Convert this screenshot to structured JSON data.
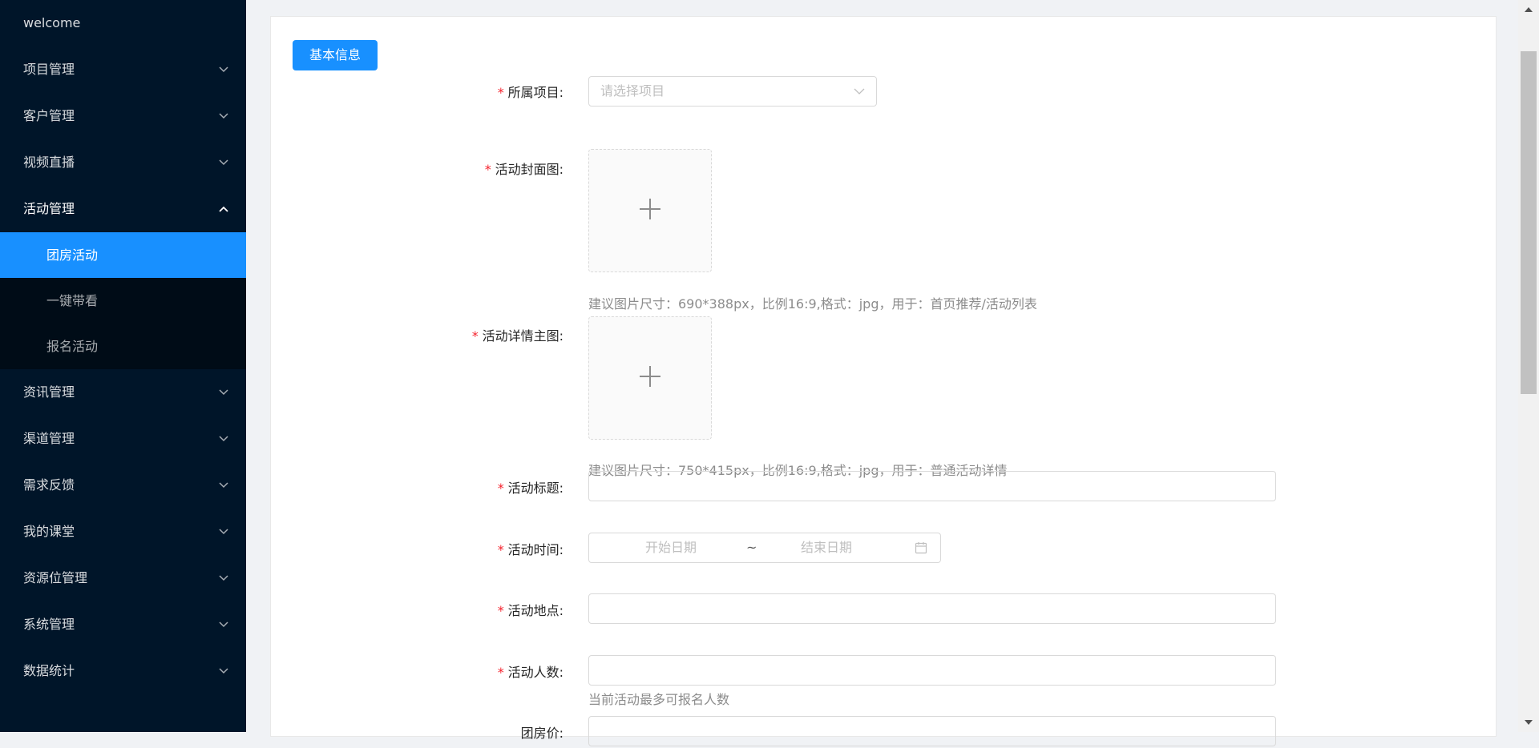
{
  "sidebar": {
    "welcome": "welcome",
    "menus_top": [
      {
        "label": "项目管理"
      },
      {
        "label": "客户管理"
      },
      {
        "label": "视频直播"
      }
    ],
    "open_menu": {
      "label": "活动管理",
      "items": [
        {
          "label": "团房活动",
          "active": true
        },
        {
          "label": "一键带看",
          "active": false
        },
        {
          "label": "报名活动",
          "active": false
        }
      ]
    },
    "menus_bottom": [
      {
        "label": "资讯管理"
      },
      {
        "label": "渠道管理"
      },
      {
        "label": "需求反馈"
      },
      {
        "label": "我的课堂"
      },
      {
        "label": "资源位管理"
      },
      {
        "label": "系统管理"
      },
      {
        "label": "数据统计"
      }
    ]
  },
  "form": {
    "section_button": "基本信息",
    "required_mark": "*",
    "project": {
      "label": "所属项目:",
      "placeholder": "请选择项目"
    },
    "cover": {
      "label": "活动封面图:",
      "hint": "建议图片尺寸：690*388px，比例16:9,格式：jpg，用于：首页推荐/活动列表"
    },
    "detail_image": {
      "label": "活动详情主图:",
      "hint": "建议图片尺寸：750*415px，比例16:9,格式：jpg，用于：普通活动详情"
    },
    "title": {
      "label": "活动标题:",
      "value": ""
    },
    "time": {
      "label": "活动时间:",
      "start_placeholder": "开始日期",
      "separator": "~",
      "end_placeholder": "结束日期"
    },
    "place": {
      "label": "活动地点:",
      "value": ""
    },
    "count": {
      "label": "活动人数:",
      "value": "",
      "hint": "当前活动最多可报名人数"
    },
    "price": {
      "label": "团房价:"
    }
  },
  "colors": {
    "sidebar_bg": "#001529",
    "submenu_bg": "#000c17",
    "accent": "#1890ff",
    "required": "#f5222d"
  }
}
